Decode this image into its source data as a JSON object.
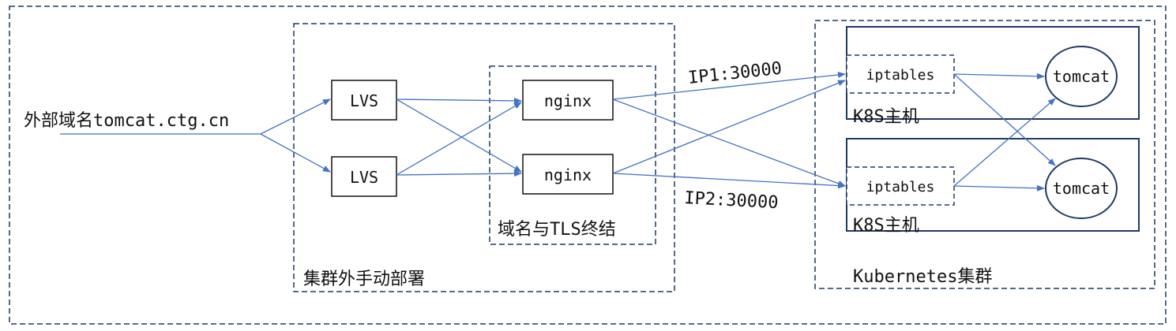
{
  "labels": {
    "external_domain": "外部域名tomcat.ctg.cn",
    "manual_cluster": "集群外手动部署",
    "tls_group": "域名与TLS终结",
    "k8s_cluster": "Kubernetes集群",
    "ip1": "IP1:30000",
    "ip2": "IP2:30000"
  },
  "nodes": {
    "lvs_top": "LVS",
    "lvs_bottom": "LVS",
    "nginx_top": "nginx",
    "nginx_bottom": "nginx",
    "iptables_top": "iptables",
    "iptables_bottom": "iptables",
    "tomcat_top": "tomcat",
    "tomcat_bottom": "tomcat"
  },
  "hosts": {
    "top": "K8S主机",
    "bottom": "K8S主机"
  },
  "colors": {
    "border": "#1f3864",
    "arrow": "#4472c4",
    "text": "#111111"
  }
}
